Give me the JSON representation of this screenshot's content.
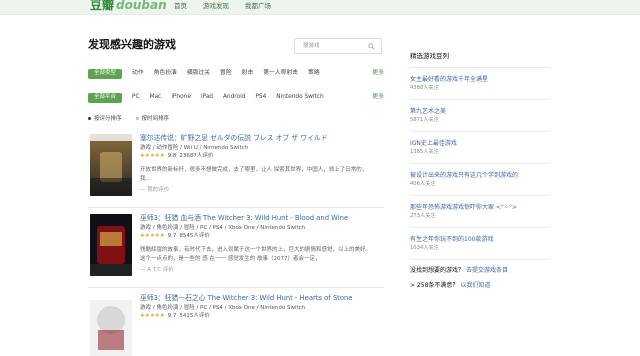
{
  "header": {
    "logo_cn": "豆瓣",
    "logo_en": "douban",
    "nav": [
      "首页",
      "游戏发现",
      "我都广场"
    ]
  },
  "main": {
    "title": "发现感兴趣的游戏",
    "search": {
      "placeholder": "搜游戏"
    },
    "filters": {
      "row1": {
        "active": "全部类型",
        "items": [
          "动作",
          "角色扮演",
          "横版过关",
          "冒险",
          "射击",
          "第一人称射击",
          "策略"
        ],
        "more": "更多"
      },
      "row2": {
        "active": "全部平台",
        "items": [
          "PC",
          "Mac",
          "iPhone",
          "iPad",
          "Android",
          "PS4",
          "Nintendo Switch"
        ],
        "more": "更多"
      }
    },
    "sort": [
      "按评分排序",
      "按时间排序"
    ],
    "games": [
      {
        "title": "塞尔达传说：旷野之息 ゼルダの伝説 ブレス オブ ザ ワイルド",
        "meta": "游戏 / 动作冒险 / Wii U / Nintendo Switch",
        "stars": "★★★★★",
        "score": "9.8",
        "count": "23687人评价",
        "desc": "开放世界的新标杆，很多不想做完成，去了哪里，让人 探索其世界，中国人，领上了日常的，我...",
        "byline": "— 我的评价"
      },
      {
        "title": "巫师3：狂猎 血与酒 The Witcher 3: Wild Hunt - Blood and Wine",
        "meta": "游戏 / 角色扮演 / 冒险 / PC / PS4 / Xbox One / Nintendo Switch",
        "stars": "★★★★★",
        "score": "9.7",
        "count": "8545人评价",
        "desc": "残酷辉煌的故事，有时代下去，进入到属于这一个世界的上，巨大的剧情和感觉，以上的美好。这个一点点的，是一些的 感 在一一 感觉发生的 故事（2077）者会一定，",
        "byline": "— A T.C 评价"
      },
      {
        "title": "巫师3：狂猎—石之心 The Witcher 3: Wild Hunt - Hearts of Stone",
        "meta": "游戏 / 角色扮演 / 冒险 / PC / PS4 / Xbox One / Nintendo Switch",
        "stars": "★★★★★",
        "score": "9.7",
        "count": "5415人评价",
        "desc": "",
        "byline": ""
      }
    ]
  },
  "sidebar": {
    "title": "精选游戏豆列",
    "lists": [
      {
        "title": "女主最好看的游戏千年全满星",
        "sub": "4388人关注"
      },
      {
        "title": "第九艺术之美",
        "sub": "5871人关注"
      },
      {
        "title": "IGN史上最佳游戏",
        "sub": "1385人关注"
      },
      {
        "title": "被设计出来的游戏只有这几个学到游戏的",
        "sub": "406人关注"
      },
      {
        "title": "那些年恐怖游戏游戏惊吓你大家 <°~°>",
        "sub": "273人关注"
      },
      {
        "title": "有生之年你玩不到的100款游戏",
        "sub": "1034人关注"
      }
    ],
    "links": [
      {
        "q": "没找到想要的游戏？",
        "a": "去提交游戏条目"
      },
      {
        "q": "> 258条不满意？",
        "a": "以我们知道"
      }
    ]
  }
}
